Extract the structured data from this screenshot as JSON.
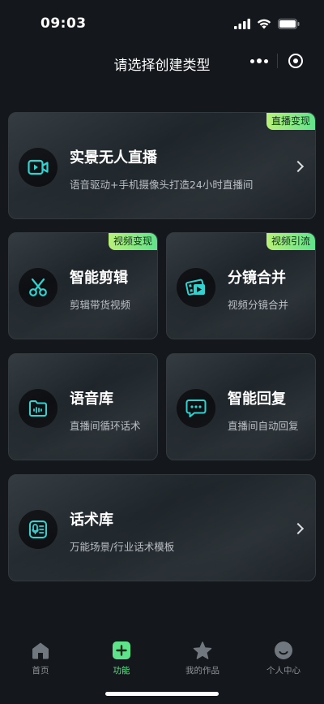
{
  "status": {
    "time": "09:03"
  },
  "header": {
    "title": "请选择创建类型"
  },
  "cards": [
    {
      "title": "实景无人直播",
      "subtitle": "语音驱动+手机摄像头打造24小时直播间",
      "badge": "直播变现",
      "icon": "video-camera-icon"
    },
    {
      "title": "智能剪辑",
      "subtitle": "剪辑带货视频",
      "badge": "视频变现",
      "icon": "scissors-icon"
    },
    {
      "title": "分镜合并",
      "subtitle": "视频分镜合并",
      "badge": "视频引流",
      "icon": "film-icon"
    },
    {
      "title": "语音库",
      "subtitle": "直播间循环话术",
      "badge": "",
      "icon": "audio-folder-icon"
    },
    {
      "title": "智能回复",
      "subtitle": "直播间自动回复",
      "badge": "",
      "icon": "chat-bubble-icon"
    },
    {
      "title": "话术库",
      "subtitle": "万能场景/行业话术模板",
      "badge": "",
      "icon": "script-mic-icon"
    }
  ],
  "tabbar": {
    "items": [
      {
        "label": "首页",
        "icon": "home-icon"
      },
      {
        "label": "功能",
        "icon": "plus-icon"
      },
      {
        "label": "我的作品",
        "icon": "star-icon"
      },
      {
        "label": "个人中心",
        "icon": "user-face-icon"
      }
    ],
    "active_index": 1
  },
  "colors": {
    "accent": "#5fe38a",
    "icon_teal": "#2fd3d0",
    "background": "#14171b"
  }
}
